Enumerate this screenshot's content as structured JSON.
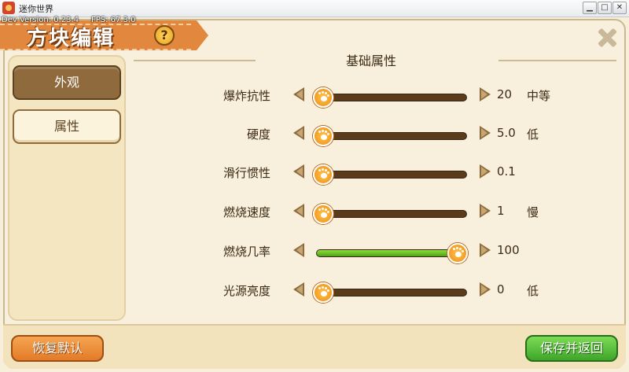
{
  "window": {
    "title": "迷你世界",
    "minimize": "▁",
    "maximize": "□",
    "close": "✕"
  },
  "dev_info": "Dev Version: 0.23.4     FPS: 67.3.0",
  "dialog": {
    "title": "方块编辑",
    "help_label": "?"
  },
  "sidebar": {
    "items": [
      {
        "label": "外观",
        "active": true
      },
      {
        "label": "属性",
        "active": false
      }
    ]
  },
  "section": {
    "title": "基础属性"
  },
  "properties": [
    {
      "label": "爆炸抗性",
      "value": "20",
      "level": "中等",
      "fill": 0.04
    },
    {
      "label": "硬度",
      "value": "5.0",
      "level": "低",
      "fill": 0.02
    },
    {
      "label": "滑行惯性",
      "value": "0.1",
      "level": "",
      "fill": 0.0
    },
    {
      "label": "燃烧速度",
      "value": "1",
      "level": "慢",
      "fill": 0.01
    },
    {
      "label": "燃烧几率",
      "value": "100",
      "level": "",
      "fill": 0.93
    },
    {
      "label": "光源亮度",
      "value": "0",
      "level": "低",
      "fill": 0.0
    }
  ],
  "footer": {
    "reset_label": "恢复默认",
    "save_label": "保存并返回"
  },
  "colors": {
    "accent": "#e2883e",
    "slider_fill": "#4da317",
    "save_button": "#3ea52a",
    "reset_button": "#e27b28"
  },
  "icons": {
    "help": "help-icon",
    "close": "close-icon",
    "arrow_left": "arrow-left-icon",
    "arrow_right": "arrow-right-icon",
    "knob": "paw-knob-icon"
  }
}
